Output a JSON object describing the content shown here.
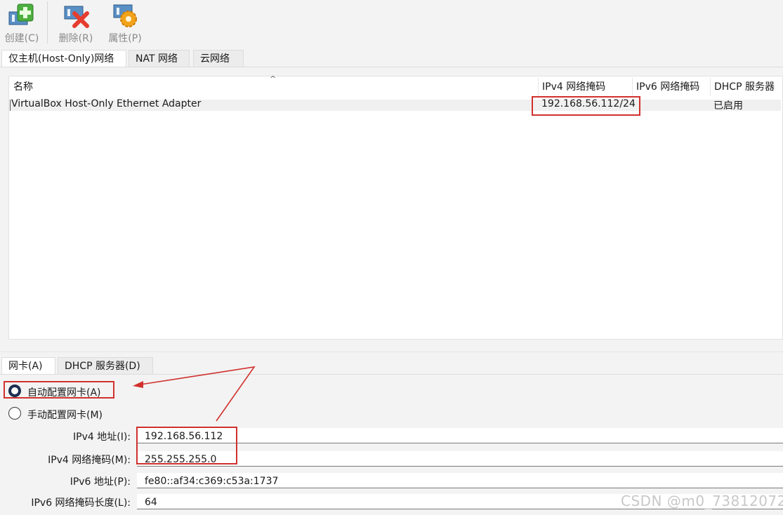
{
  "toolbar": {
    "create_label": "创建(C)",
    "delete_label": "删除(R)",
    "properties_label": "属性(P)"
  },
  "top_tabs": [
    "仅主机(Host-Only)网络",
    "NAT 网络",
    "云网络"
  ],
  "table": {
    "columns": [
      "名称",
      "IPv4 网络掩码",
      "IPv6 网络掩码",
      "DHCP 服务器"
    ],
    "rows": [
      {
        "name": "VirtualBox Host-Only Ethernet Adapter",
        "ipv4": "192.168.56.112/24",
        "ipv6": "",
        "dhcp": "已启用"
      }
    ]
  },
  "detail_tabs": [
    "网卡(A)",
    "DHCP 服务器(D)"
  ],
  "form": {
    "auto_label": "自动配置网卡(A)",
    "manual_label": "手动配置网卡(M)",
    "auto_selected": true,
    "ipv4_addr_label": "IPv4 地址(I):",
    "ipv4_addr_value": "192.168.56.112",
    "ipv4_mask_label": "IPv4 网络掩码(M):",
    "ipv4_mask_value": "255.255.255.0",
    "ipv6_addr_label": "IPv6 地址(P):",
    "ipv6_addr_value": "fe80::af34:c369:c53a:1737",
    "ipv6_prefix_label": "IPv6 网络掩码长度(L):",
    "ipv6_prefix_value": "64"
  },
  "colors": {
    "highlight_box": "#d0312d",
    "accent": "#1d2f4f"
  },
  "watermark": "CSDN @m0_73812072"
}
